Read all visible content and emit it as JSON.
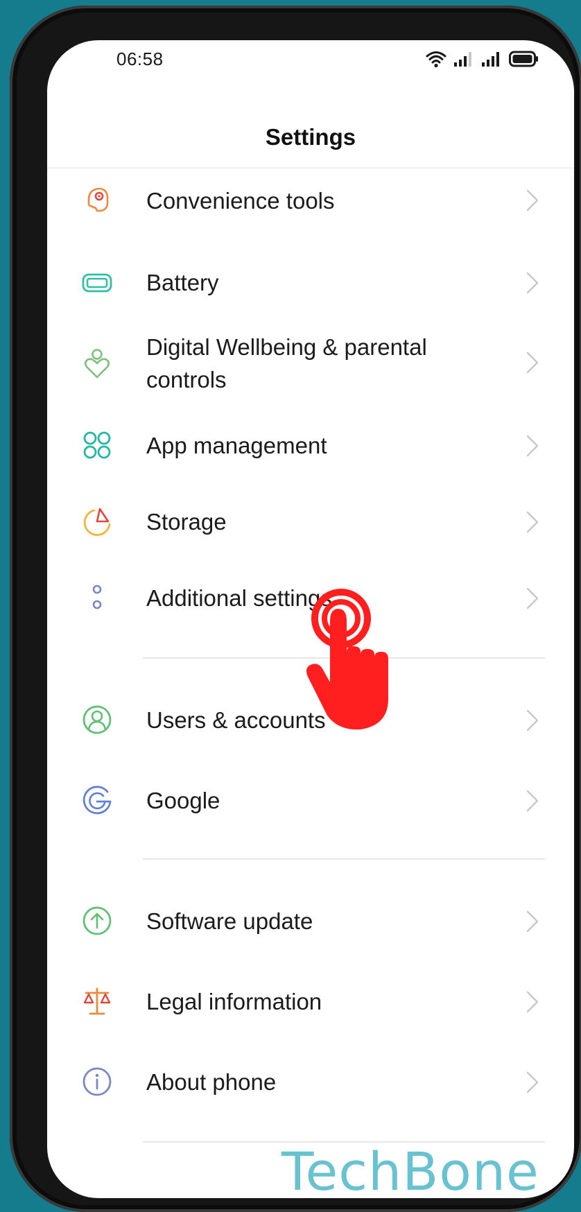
{
  "status_bar": {
    "time": "06:58",
    "icons": [
      "wifi-icon",
      "signal-icon",
      "signal-icon",
      "battery-icon"
    ]
  },
  "header": {
    "title": "Settings"
  },
  "settings": {
    "items": [
      {
        "label": "Convenience tools",
        "icon": "convenience-tools-icon",
        "color": "#f0883c"
      },
      {
        "label": "Battery",
        "icon": "battery-icon",
        "color": "#2fbfa5"
      },
      {
        "label": "Digital Wellbeing & parental",
        "label_line2": "controls",
        "icon": "digital-wellbeing-icon",
        "color": "#7cc07c"
      },
      {
        "label": "App management",
        "icon": "app-management-icon",
        "color": "#23b7a8"
      },
      {
        "label": "Storage",
        "icon": "storage-icon",
        "color": "#f2b43a"
      },
      {
        "label": "Additional settings",
        "icon": "additional-settings-icon",
        "color": "#7b86c4"
      },
      {
        "label": "Users & accounts",
        "icon": "users-accounts-icon",
        "color": "#5fbf73"
      },
      {
        "label": "Google",
        "icon": "google-icon",
        "color": "#5f7fd8"
      },
      {
        "label": "Software update",
        "icon": "software-update-icon",
        "color": "#5fbf73"
      },
      {
        "label": "Legal information",
        "icon": "legal-information-icon",
        "color": "#f0883c"
      },
      {
        "label": "About phone",
        "icon": "about-phone-icon",
        "color": "#7b86c4"
      }
    ]
  },
  "watermark": {
    "text": "TechBone",
    "color": "#68c2cf"
  },
  "tap_indicator": {
    "icon": "tap-hand-icon",
    "color": "#ff1f1f"
  }
}
